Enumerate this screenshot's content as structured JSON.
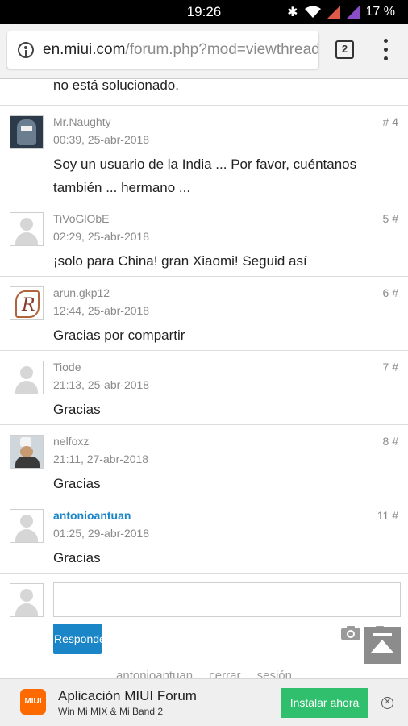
{
  "status_bar": {
    "time": "19:26",
    "battery": "17 %"
  },
  "browser": {
    "url_domain": "en.miui.com",
    "url_path": "/forum.php?mod=viewthread",
    "tab_count": "2"
  },
  "thread": {
    "top_fragment": "no está solucionado.",
    "posts": [
      {
        "author": "Mr.Naughty",
        "date": "00:39, 25-abr-2018",
        "num": "# 4",
        "content": "Soy un usuario de la India ... Por favor, cuéntanos también ... hermano ..."
      },
      {
        "author": "TiVoGlObE",
        "date": "02:29, 25-abr-2018",
        "num": "5 #",
        "content": "¡solo para China! gran Xiaomi! Seguid así"
      },
      {
        "author": "arun.gkp12",
        "date": "12:44, 25-abr-2018",
        "num": "6 #",
        "content": "Gracias por compartir"
      },
      {
        "author": "Tiode",
        "date": "21:13, 25-abr-2018",
        "num": "7 #",
        "content": "Gracias"
      },
      {
        "author": "nelfoxz",
        "date": "21:11, 27-abr-2018",
        "num": "8 #",
        "content": "Gracias"
      },
      {
        "author": "antonioantuan",
        "date": "01:25, 29-abr-2018",
        "num": "11 #",
        "content": "Gracias"
      }
    ]
  },
  "reply": {
    "button_label": "Responder",
    "input_value": ""
  },
  "footer": {
    "user": "antonioantuan",
    "logout_1": "cerrar",
    "logout_2": "sesión"
  },
  "app_banner": {
    "logo_text": "MIUI",
    "title": "Aplicación MIUI Forum",
    "subtitle": "Win Mi MIX & Mi Band 2",
    "install_label": "Instalar ahora",
    "close_glyph": "✕"
  },
  "colors": {
    "accent_blue": "#1a86c8",
    "install_green": "#2fbf6d",
    "miui_orange": "#ff6a00"
  }
}
